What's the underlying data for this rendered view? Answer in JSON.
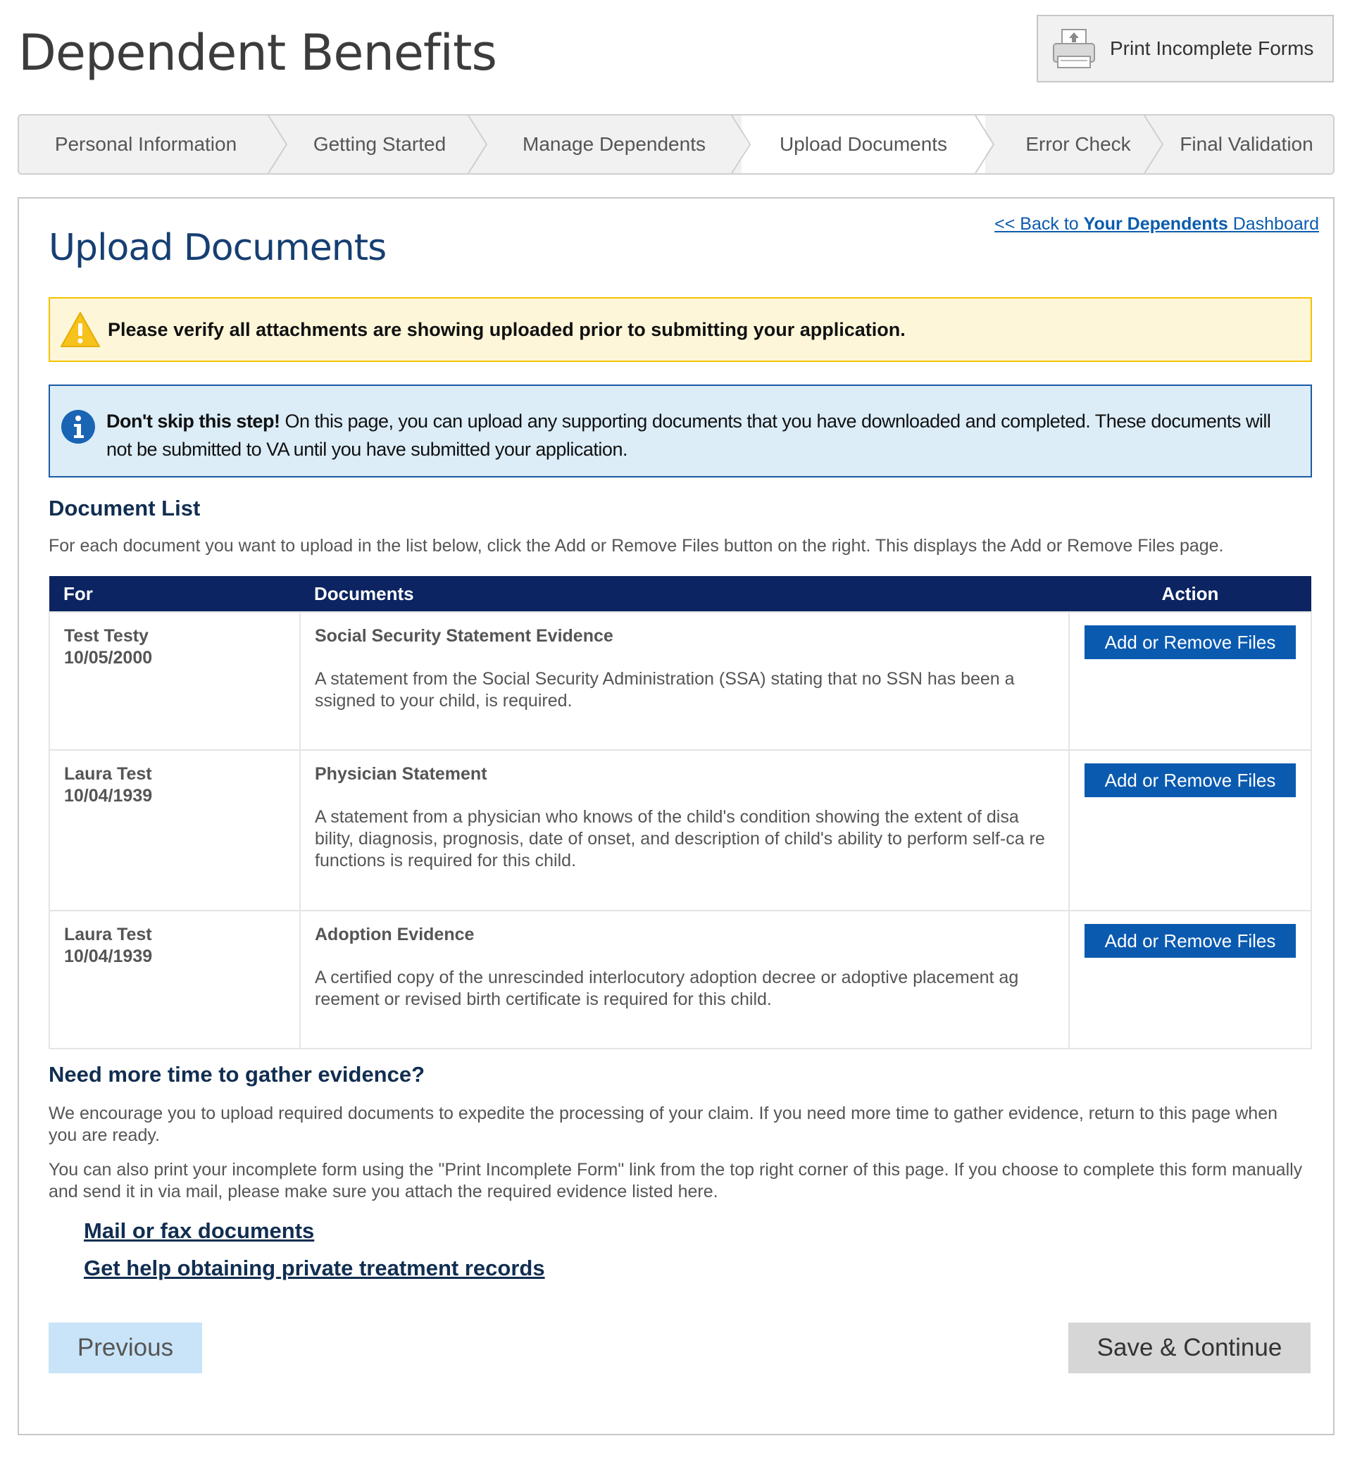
{
  "app": {
    "title": "Dependent Benefits",
    "print_button_label": "Print Incomplete Forms",
    "print_icon": "printer-icon"
  },
  "steps": [
    {
      "label": "Personal Information",
      "active": false
    },
    {
      "label": "Getting Started",
      "active": false
    },
    {
      "label": "Manage Dependents",
      "active": false
    },
    {
      "label": "Upload Documents",
      "active": true
    },
    {
      "label": "Error Check",
      "active": false
    },
    {
      "label": "Final Validation",
      "active": false
    }
  ],
  "main": {
    "back_link": {
      "prefix": "<< Back to ",
      "bold": "Your Dependents",
      "suffix": " Dashboard"
    },
    "title": "Upload Documents",
    "warning": {
      "icon": "warning-icon",
      "text": "Please verify all attachments are showing uploaded prior to submitting your application."
    },
    "info": {
      "icon": "info-icon",
      "bold": "Don't skip this step!",
      "text": " On this page, you can upload any supporting documents that you have downloaded and completed. These documents will not be submitted to VA until you have submitted your application."
    },
    "document_list": {
      "heading": "Document List",
      "description": "For each document you want to upload in the list below, click the Add or Remove Files button on the right. This displays the Add or Remove Files page.",
      "columns": {
        "for": "For",
        "documents": "Documents",
        "action": "Action"
      },
      "rows": [
        {
          "name": "Test Testy",
          "dob": "10/05/2000",
          "doc_title": "Social Security Statement Evidence",
          "doc_desc": "A statement from the Social Security Administration (SSA) stating that no SSN has been a ssigned to your child, is required.",
          "action_label": "Add or Remove Files"
        },
        {
          "name": "Laura Test",
          "dob": "10/04/1939",
          "doc_title": "Physician Statement",
          "doc_desc": "A statement from a physician who knows of the child's condition showing the extent of disa bility, diagnosis, prognosis, date of onset, and description of child's ability to perform self-ca re functions is required for this child.",
          "action_label": "Add or Remove Files"
        },
        {
          "name": "Laura Test",
          "dob": "10/04/1939",
          "doc_title": "Adoption Evidence",
          "doc_desc": "A certified copy of the unrescinded interlocutory adoption decree or adoptive placement ag reement or revised birth certificate is required for this child.",
          "action_label": "Add or Remove Files"
        }
      ]
    },
    "more_time": {
      "heading": "Need more time to gather evidence?",
      "para1": "We encourage you to upload required documents to expedite the processing of your claim. If you need more time to gather evidence, return to this page when you are ready.",
      "para2": "You can also print your incomplete form using the \"Print Incomplete Form\" link from the top right corner of this page. If you choose to complete this form manually and send it in via mail, please make sure you attach the required evidence listed here.",
      "links": [
        "Mail or fax documents",
        "Get help obtaining private treatment records"
      ]
    },
    "buttons": {
      "previous": "Previous",
      "save_continue": "Save & Continue"
    }
  },
  "colors": {
    "header_navy": "#0c2461",
    "title_blue": "#163f72",
    "button_blue": "#0a5ab0",
    "warning_bg": "#fdf6d9",
    "warning_border": "#f3c300",
    "info_bg": "#dcedf8",
    "info_border": "#1a5ba6"
  }
}
